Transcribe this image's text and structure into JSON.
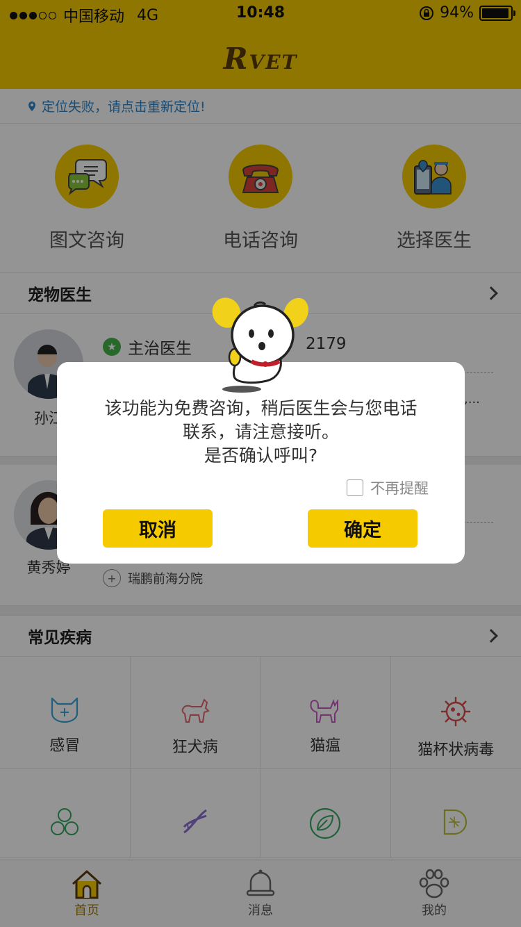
{
  "status_bar": {
    "carrier": "中国移动",
    "network": "4G",
    "time": "10:48",
    "battery": "94%",
    "battery_level": 0.94
  },
  "header": {
    "logo_big": "R",
    "logo_small": "VET"
  },
  "location": {
    "text": "定位失败，请点击重新定位!"
  },
  "quick_actions": [
    {
      "label": "图文咨询",
      "icon": "chat-bubbles-icon"
    },
    {
      "label": "电话咨询",
      "icon": "telephone-icon"
    },
    {
      "label": "选择医生",
      "icon": "doctor-icon"
    }
  ],
  "pet_doctors": {
    "title": "宠物医生",
    "doctors": [
      {
        "name": "孙江",
        "title": "主治医生",
        "count": "2179",
        "fragment": "科,..."
      },
      {
        "name": "黄秀婷",
        "hospital": "瑞鹏前海分院"
      }
    ]
  },
  "common_diseases": {
    "title": "常见疾病",
    "items": [
      {
        "label": "感冒",
        "icon": "cat-face-icon",
        "color": "#3aa5d8"
      },
      {
        "label": "狂犬病",
        "icon": "dog-icon",
        "color": "#e2646f"
      },
      {
        "label": "猫瘟",
        "icon": "cat-icon",
        "color": "#c45cc4"
      },
      {
        "label": "猫杯状病毒",
        "icon": "virus-icon",
        "color": "#d94b4b"
      },
      {
        "label": "",
        "icon": "cells-icon",
        "color": "#35a764"
      },
      {
        "label": "",
        "icon": "dna-icon",
        "color": "#8a6fd1"
      },
      {
        "label": "",
        "icon": "leaf-icon",
        "color": "#35a764"
      },
      {
        "label": "",
        "icon": "d-circuit-icon",
        "color": "#b9c23a"
      }
    ]
  },
  "tabbar": {
    "tabs": [
      {
        "label": "首页",
        "icon": "home-icon",
        "active": true
      },
      {
        "label": "消息",
        "icon": "bell-icon",
        "active": false
      },
      {
        "label": "我的",
        "icon": "paw-icon",
        "active": false
      }
    ]
  },
  "dialog": {
    "line1": "该功能为免费咨询，稍后医生会与您电话",
    "line2": "联系，请注意接听。",
    "line3": "是否确认呼叫?",
    "dont_remind": "不再提醒",
    "cancel": "取消",
    "confirm": "确定"
  },
  "colors": {
    "brand": "#f5cb00",
    "link": "#2f86c9"
  }
}
